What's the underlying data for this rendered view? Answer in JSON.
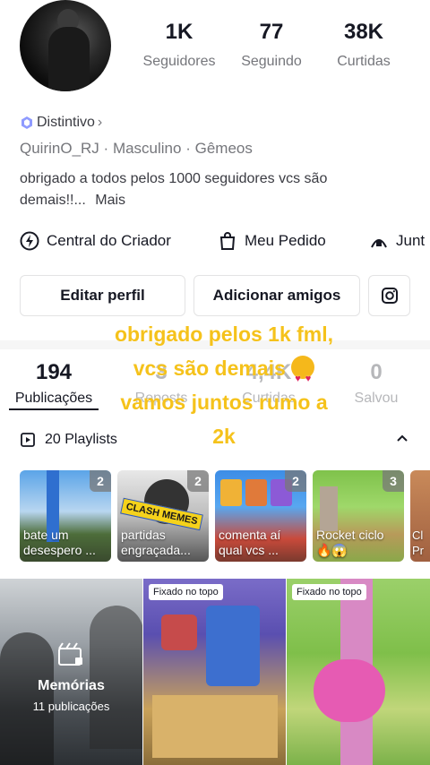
{
  "profile": {
    "stats": [
      {
        "value": "1K",
        "label": "Seguidores"
      },
      {
        "value": "77",
        "label": "Seguindo"
      },
      {
        "value": "38K",
        "label": "Curtidas"
      }
    ],
    "badge_label": "Distintivo",
    "meta": [
      "QuirinO_RJ",
      "Masculino",
      "Gêmeos"
    ],
    "bio_line1": "obrigado a todos pelos 1000 seguidores vcs são",
    "bio_line2": "demais!!...",
    "bio_more": "Mais"
  },
  "actions": [
    {
      "label": "Central do Criador",
      "icon": "lightning-icon"
    },
    {
      "label": "Meu Pedido",
      "icon": "shopping-bag-icon"
    },
    {
      "label": "Junt",
      "icon": "group-icon"
    }
  ],
  "buttons": {
    "edit": "Editar perfil",
    "add_friends": "Adicionar amigos",
    "instagram_icon": "instagram-icon"
  },
  "overlay": {
    "line1": "obrigado pelos 1k fml,",
    "line2": "vcs são demais",
    "line3": "vamos juntos rumo a",
    "line4": "2k"
  },
  "tabs": [
    {
      "value": "194",
      "label": "Publicações",
      "active": true
    },
    {
      "value": "3",
      "label": "Reposts"
    },
    {
      "value": "4,4K",
      "label": "Curtidas"
    },
    {
      "value": "0",
      "label": "Salvou"
    }
  ],
  "playlists": {
    "header": "20 Playlists",
    "items": [
      {
        "title": "bate um desespero ...",
        "count": "2"
      },
      {
        "title": "partidas engraçada...",
        "count": "2",
        "sticker": "CLASH MEMES"
      },
      {
        "title": "comenta aí qual vcs ...",
        "count": "2"
      },
      {
        "title": "Rocket ciclo 🔥😱",
        "count": "3"
      },
      {
        "title": "Cl Pr",
        "count": ""
      }
    ]
  },
  "grid": {
    "memories_title": "Memórias",
    "memories_sub": "11 publicações",
    "pinned_label_1": "Fixado no topo",
    "pinned_label_2": "Fixado no topo"
  },
  "colors": {
    "accent_overlay": "#f5c21b",
    "badge_blue": "#6b7cff"
  }
}
